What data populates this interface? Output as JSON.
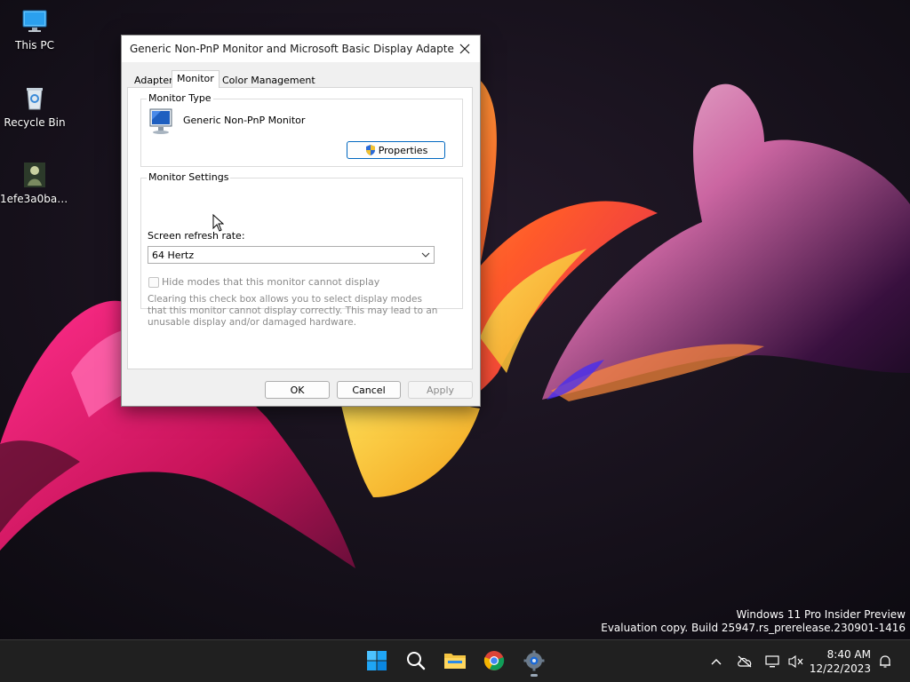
{
  "desktop": {
    "icons": [
      {
        "label": "This PC"
      },
      {
        "label": "Recycle Bin"
      },
      {
        "label": "1efe3a0bae..."
      }
    ],
    "watermark": {
      "line1": "Windows 11 Pro Insider Preview",
      "line2": "Evaluation copy. Build 25947.rs_prerelease.230901-1416"
    }
  },
  "dialog": {
    "title": "Generic Non-PnP Monitor and Microsoft Basic Display Adapter Pro...",
    "tabs": [
      {
        "label": "Adapter"
      },
      {
        "label": "Monitor"
      },
      {
        "label": "Color Management"
      }
    ],
    "monitor_type": {
      "legend": "Monitor Type",
      "name": "Generic Non-PnP Monitor",
      "properties_button": "Properties"
    },
    "monitor_settings": {
      "legend": "Monitor Settings",
      "refresh_label": "Screen refresh rate:",
      "refresh_value": "64 Hertz",
      "hide_modes_label": "Hide modes that this monitor cannot display",
      "hide_modes_checked": false,
      "warning": "Clearing this check box allows you to select display modes that this monitor cannot display correctly. This may lead to an unusable display and/or damaged hardware."
    },
    "buttons": {
      "ok": "OK",
      "cancel": "Cancel",
      "apply": "Apply"
    }
  },
  "taskbar": {
    "apps": [
      "start-icon",
      "search-icon",
      "file-explorer-icon",
      "chrome-icon",
      "settings-icon"
    ],
    "clock": {
      "time": "8:40 AM",
      "date": "12/22/2023"
    }
  },
  "colors": {
    "accent": "#0067c0",
    "taskbar": "#202020"
  }
}
